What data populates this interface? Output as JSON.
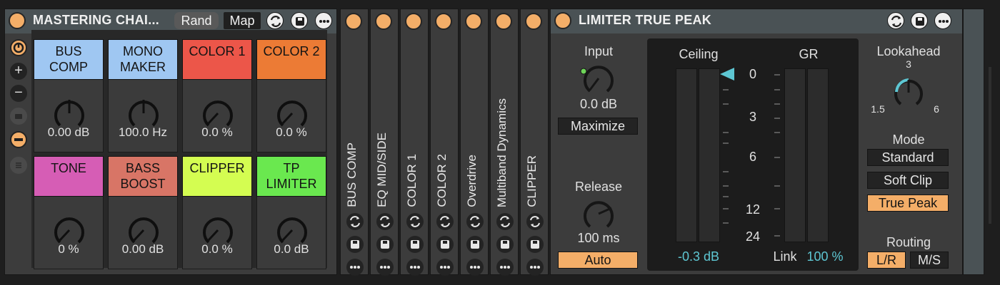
{
  "rack": {
    "title": "MASTERING CHAI...",
    "rand_label": "Rand",
    "map_label": "Map",
    "macros": [
      {
        "label_line1": "BUS",
        "label_line2": "COMP",
        "value": "0.00 dB",
        "color": "#9fc7f2"
      },
      {
        "label_line1": "MONO",
        "label_line2": "MAKER",
        "value": "100.0 Hz",
        "color": "#9fc7f2"
      },
      {
        "label_line1": "COLOR 1",
        "label_line2": "",
        "value": "0.0 %",
        "color": "#ec5649"
      },
      {
        "label_line1": "COLOR 2",
        "label_line2": "",
        "value": "0.0 %",
        "color": "#ec7b35"
      },
      {
        "label_line1": "TONE",
        "label_line2": "",
        "value": "0 %",
        "color": "#d65db5"
      },
      {
        "label_line1": "BASS",
        "label_line2": "BOOST",
        "value": "0.00 dB",
        "color": "#d87566"
      },
      {
        "label_line1": "CLIPPER",
        "label_line2": "",
        "value": "0.0 %",
        "color": "#d4fd51"
      },
      {
        "label_line1": "TP",
        "label_line2": "LIMITER",
        "value": "0.0 dB",
        "color": "#6ae84f"
      }
    ]
  },
  "chain": [
    {
      "label": "BUS COMP"
    },
    {
      "label": "EQ MID/SIDE"
    },
    {
      "label": "COLOR 1"
    },
    {
      "label": "COLOR 2"
    },
    {
      "label": "Overdrive"
    },
    {
      "label": "Multiband Dynamics"
    },
    {
      "label": "CLIPPER"
    }
  ],
  "limiter": {
    "title": "LIMITER TRUE PEAK",
    "input_label": "Input",
    "input_value": "0.0 dB",
    "maximize_label": "Maximize",
    "release_label": "Release",
    "release_value": "100 ms",
    "auto_label": "Auto",
    "ceiling_label": "Ceiling",
    "gr_label": "GR",
    "scale": [
      "0",
      "3",
      "6",
      "12",
      "24"
    ],
    "ceiling_value": "-0.3 dB",
    "link_label": "Link",
    "link_value": "100 %",
    "lookahead_label": "Lookahead",
    "lookahead_marks": {
      "min": "1.5",
      "mid": "3",
      "max": "6"
    },
    "mode_label": "Mode",
    "modes": [
      "Standard",
      "Soft Clip",
      "True Peak"
    ],
    "active_mode": "True Peak",
    "routing_label": "Routing",
    "routing": [
      "L/R",
      "M/S"
    ],
    "active_routing": "L/R"
  },
  "colors": {
    "accent": "#f4ae68",
    "teal": "#5ec7d3",
    "header": "#4a5255"
  }
}
